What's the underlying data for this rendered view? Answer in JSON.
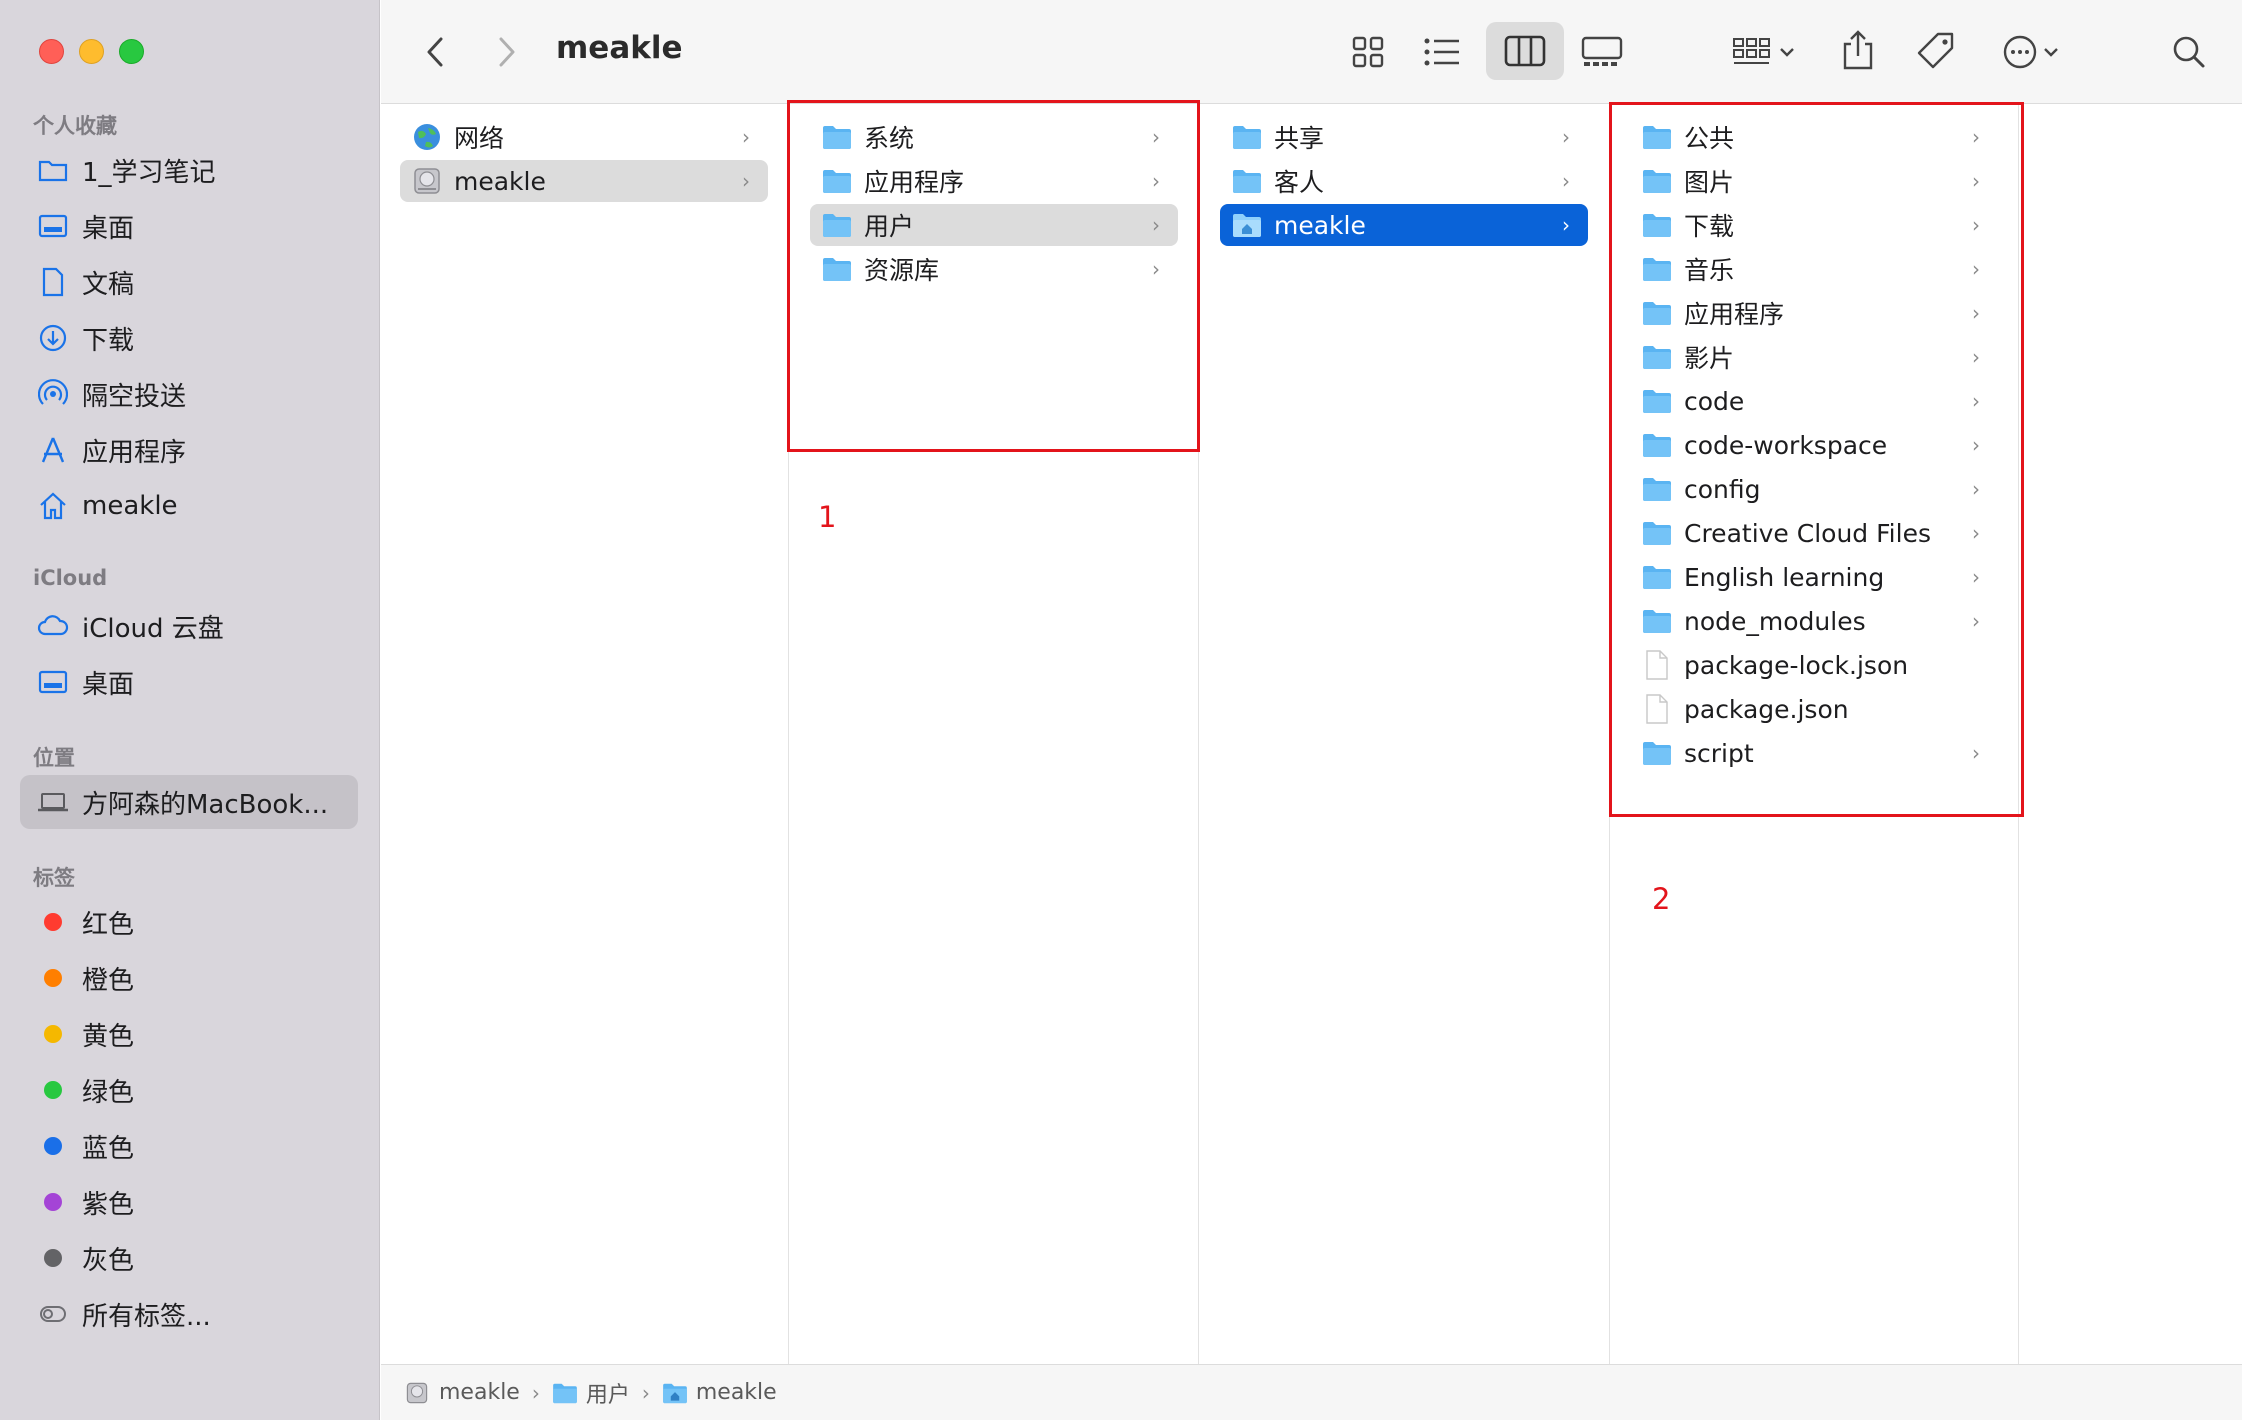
{
  "window": {
    "title": "meakle"
  },
  "sidebar": {
    "favorites_header": "个人收藏",
    "favorites": [
      {
        "label": "1_学习笔记",
        "icon": "folder-icon"
      },
      {
        "label": "桌面",
        "icon": "desktop-icon"
      },
      {
        "label": "文稿",
        "icon": "document-icon"
      },
      {
        "label": "下载",
        "icon": "download-icon"
      },
      {
        "label": "隔空投送",
        "icon": "airdrop-icon"
      },
      {
        "label": "应用程序",
        "icon": "applications-icon"
      },
      {
        "label": "meakle",
        "icon": "home-icon"
      }
    ],
    "icloud_header": "iCloud",
    "icloud": [
      {
        "label": "iCloud 云盘",
        "icon": "cloud-icon"
      },
      {
        "label": "桌面",
        "icon": "desktop-icon"
      }
    ],
    "locations_header": "位置",
    "locations": [
      {
        "label": "方阿森的MacBook...",
        "icon": "laptop-icon"
      }
    ],
    "tags_header": "标签",
    "tags": [
      {
        "label": "红色",
        "color": "#ff3b30"
      },
      {
        "label": "橙色",
        "color": "#ff7f00"
      },
      {
        "label": "黄色",
        "color": "#f5b800"
      },
      {
        "label": "绿色",
        "color": "#28c840"
      },
      {
        "label": "蓝色",
        "color": "#1a6fe8"
      },
      {
        "label": "紫色",
        "color": "#a444d6"
      },
      {
        "label": "灰色",
        "color": "#636366"
      }
    ],
    "all_tags": "所有标签..."
  },
  "columns": {
    "col1": [
      {
        "label": "网络",
        "icon": "network-globe-icon"
      },
      {
        "label": "meakle",
        "icon": "hard-drive-icon"
      }
    ],
    "col2": [
      {
        "label": "系统",
        "icon": "folder-icon"
      },
      {
        "label": "应用程序",
        "icon": "folder-icon"
      },
      {
        "label": "用户",
        "icon": "folder-icon"
      },
      {
        "label": "资源库",
        "icon": "folder-icon"
      }
    ],
    "col3": [
      {
        "label": "共享",
        "icon": "folder-icon"
      },
      {
        "label": "客人",
        "icon": "folder-icon"
      },
      {
        "label": "meakle",
        "icon": "home-folder-icon"
      }
    ],
    "col4": [
      {
        "label": "公共",
        "icon": "folder-icon"
      },
      {
        "label": "图片",
        "icon": "folder-icon"
      },
      {
        "label": "下载",
        "icon": "folder-icon"
      },
      {
        "label": "音乐",
        "icon": "folder-icon"
      },
      {
        "label": "应用程序",
        "icon": "folder-icon"
      },
      {
        "label": "影片",
        "icon": "folder-icon"
      },
      {
        "label": "code",
        "icon": "folder-icon"
      },
      {
        "label": "code-workspace",
        "icon": "folder-icon"
      },
      {
        "label": "config",
        "icon": "folder-icon"
      },
      {
        "label": "Creative Cloud Files",
        "icon": "folder-icon"
      },
      {
        "label": "English learning",
        "icon": "folder-icon"
      },
      {
        "label": "node_modules",
        "icon": "folder-icon"
      },
      {
        "label": "package-lock.json",
        "icon": "file-icon"
      },
      {
        "label": "package.json",
        "icon": "file-icon"
      },
      {
        "label": "script",
        "icon": "folder-icon"
      }
    ]
  },
  "annotations": {
    "box1_label": "1",
    "box2_label": "2",
    "color": "#e3141b"
  },
  "pathbar": [
    {
      "label": "meakle",
      "icon": "hard-drive-icon"
    },
    {
      "label": "用户",
      "icon": "folder-icon"
    },
    {
      "label": "meakle",
      "icon": "home-folder-icon"
    }
  ],
  "colors": {
    "selection": "#0a63d8",
    "folder": "#5ab4f2"
  }
}
